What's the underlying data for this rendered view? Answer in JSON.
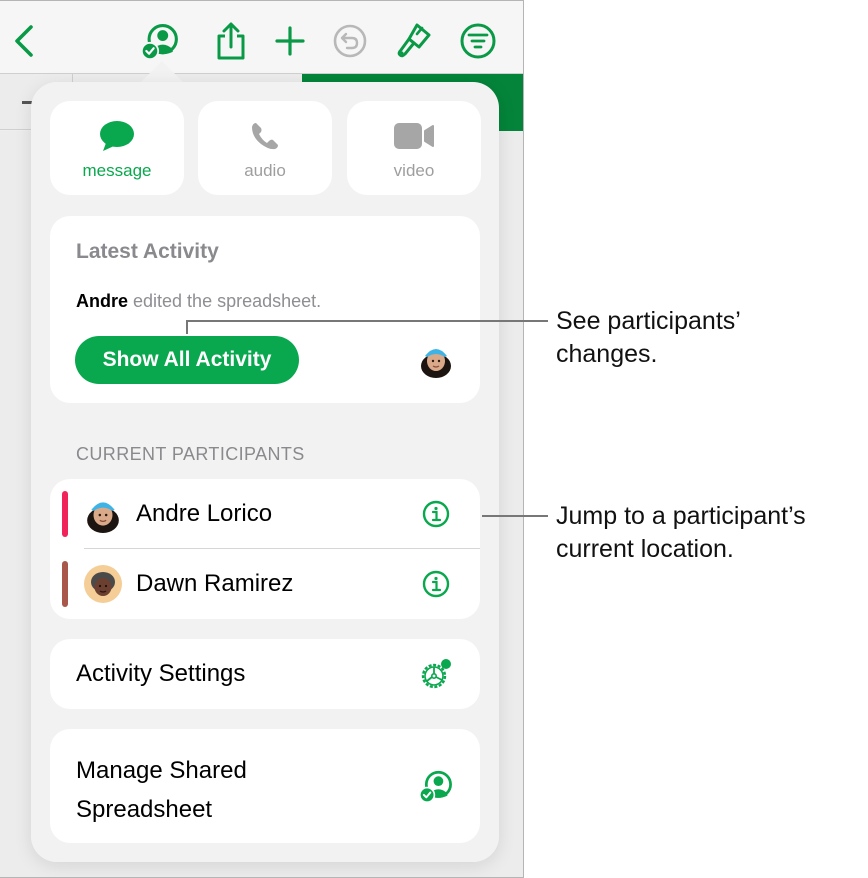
{
  "toolbar": {
    "icons": [
      "back-chevron",
      "collaboration",
      "share",
      "add",
      "undo",
      "format-brush",
      "organize"
    ],
    "accent_color": "#0aa84e",
    "disabled_color": "#b8b8b8"
  },
  "popover": {
    "communication": [
      {
        "label": "message",
        "icon": "message-bubble",
        "active": true
      },
      {
        "label": "audio",
        "icon": "phone",
        "active": false
      },
      {
        "label": "video",
        "icon": "video-camera",
        "active": false
      }
    ],
    "latest_activity": {
      "title": "Latest Activity",
      "actor": "Andre",
      "action": " edited the spreadsheet.",
      "button_label": "Show All Activity"
    },
    "participants_label": "CURRENT PARTICIPANTS",
    "participants": [
      {
        "name": "Andre Lorico",
        "color": "#f0245a"
      },
      {
        "name": "Dawn Ramirez",
        "color": "#a8574a"
      }
    ],
    "activity_settings_label": "Activity Settings",
    "manage_label": "Manage Shared Spreadsheet"
  },
  "callouts": [
    {
      "text_line1": "See participants’",
      "text_line2": "changes."
    },
    {
      "text_line1": "Jump to a participant’s",
      "text_line2": "current location."
    }
  ],
  "colors": {
    "accent": "#0aa84e",
    "muted_text": "#8a8a8e",
    "disabled_icon": "#a8a8a8"
  }
}
